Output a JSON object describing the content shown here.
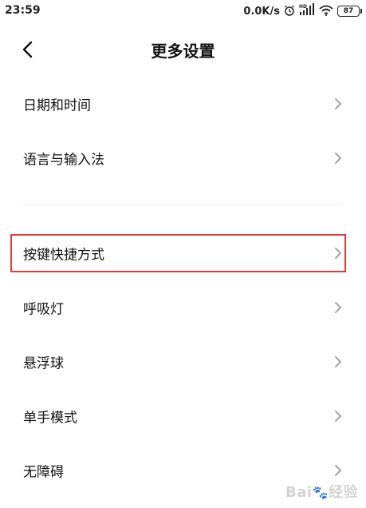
{
  "status_bar": {
    "time": "23:59",
    "network_speed": "0.0K/s",
    "battery": "87",
    "icons": [
      "alarm-icon",
      "hd-signal-icon",
      "wifi-icon",
      "battery-icon"
    ]
  },
  "header": {
    "title": "更多设置",
    "back_icon": "chevron-left-icon"
  },
  "settings": {
    "items": [
      {
        "label": "日期和时间"
      },
      {
        "label": "语言与输入法"
      },
      {
        "label": "按键快捷方式"
      },
      {
        "label": "呼吸灯"
      },
      {
        "label": "悬浮球"
      },
      {
        "label": "单手模式"
      },
      {
        "label": "无障碍"
      }
    ]
  },
  "annotation": {
    "highlight_color": "#e03b3b",
    "highlighted_item": "按键快捷方式"
  },
  "watermark": {
    "brand": "Bai",
    "brand_suffix": "经验"
  }
}
